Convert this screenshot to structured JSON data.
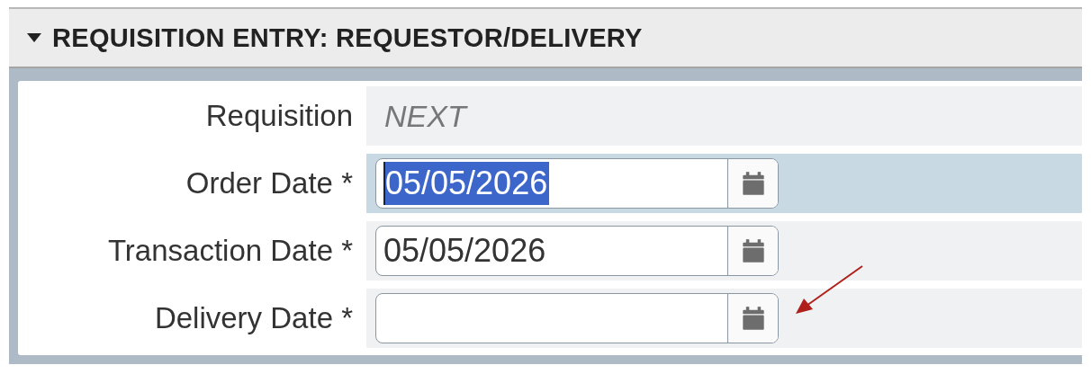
{
  "section": {
    "title": "REQUISITION ENTRY: REQUESTOR/DELIVERY",
    "expanded": true
  },
  "rows": [
    {
      "label": "Requisition",
      "kind": "display",
      "value": "NEXT",
      "selected": false
    },
    {
      "label": "Order Date *",
      "kind": "date",
      "value": "05/05/2026",
      "selected": true,
      "text_selected": true
    },
    {
      "label": "Transaction Date *",
      "kind": "date",
      "value": "05/05/2026",
      "selected": false,
      "text_selected": false
    },
    {
      "label": "Delivery Date *",
      "kind": "date",
      "value": "",
      "selected": false
    }
  ],
  "annotation": {
    "kind": "arrow"
  }
}
